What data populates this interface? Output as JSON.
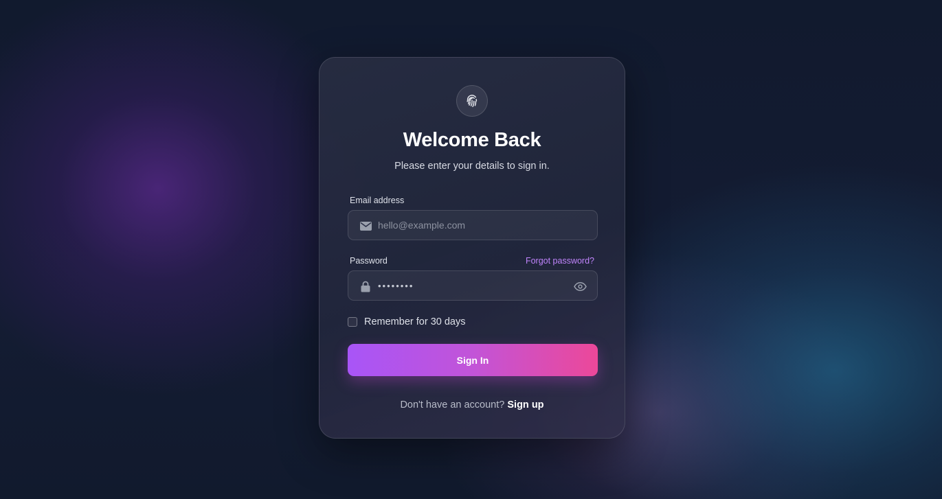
{
  "page": {
    "title": "Welcome Back",
    "subtitle": "Please enter your details to sign in."
  },
  "logo": {
    "icon": "fingerprint-icon"
  },
  "email": {
    "label": "Email address",
    "placeholder": "hello@example.com",
    "value": "",
    "icon": "envelope-icon"
  },
  "password": {
    "label": "Password",
    "value": "••••••••",
    "icon": "lock-icon",
    "toggle_icon": "eye-icon",
    "forgot_label": "Forgot password?"
  },
  "remember": {
    "label": "Remember for 30 days",
    "checked": false
  },
  "signin": {
    "label": "Sign In"
  },
  "footer": {
    "prompt": "Don't have an account?",
    "link": "Sign up"
  },
  "colors": {
    "accent_start": "#a855f7",
    "accent_end": "#ec4899",
    "link": "#c084fc"
  }
}
